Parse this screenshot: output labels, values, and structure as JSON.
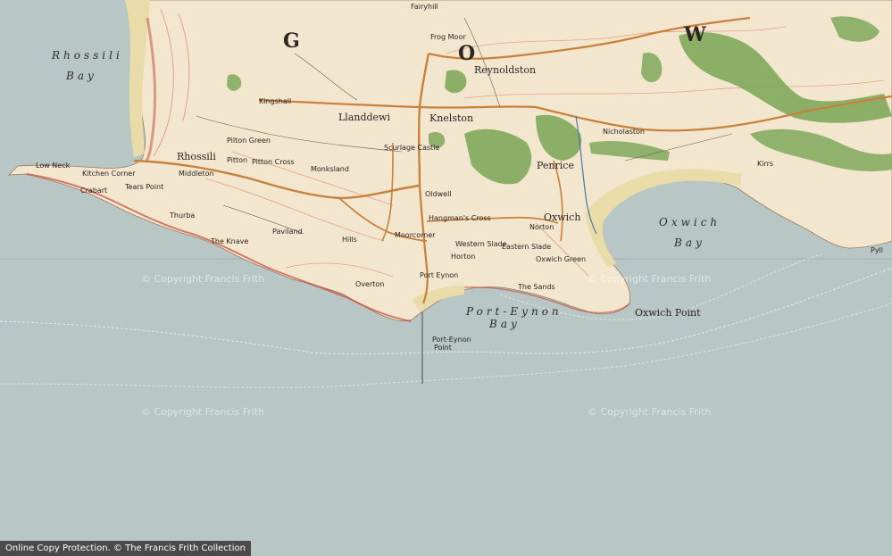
{
  "colors": {
    "sea": "#b9c6c6",
    "land": "#f3e6cf",
    "sand": "#e9dca8",
    "woodland": "#7fa85a",
    "road": "#c8813a",
    "contour": "#e3a08a",
    "cliff": "#c24a3a"
  },
  "bays": {
    "rhossili": [
      "Rhossili",
      "Bay"
    ],
    "oxwich": [
      "Oxwich",
      "Bay"
    ],
    "port_eynon": [
      "Port-Eynon",
      "Bay"
    ]
  },
  "big_letters": [
    "G",
    "O",
    "W"
  ],
  "places": [
    {
      "id": "rhossili",
      "text": "Rhossili"
    },
    {
      "id": "llanddewi",
      "text": "Llanddewi"
    },
    {
      "id": "knelston",
      "text": "Knelston"
    },
    {
      "id": "reynoldston",
      "text": "Reynoldston"
    },
    {
      "id": "penrice",
      "text": "Penrice"
    },
    {
      "id": "oxwich",
      "text": "Oxwich"
    },
    {
      "id": "port-eynon",
      "text": "Port Eynon"
    },
    {
      "id": "horton",
      "text": "Horton"
    },
    {
      "id": "overton",
      "text": "Overton"
    },
    {
      "id": "scurlage",
      "text": "Scurlage Castle"
    },
    {
      "id": "pitton",
      "text": "Pitton"
    },
    {
      "id": "middleton",
      "text": "Middleton"
    },
    {
      "id": "kingshall",
      "text": "Kingshall"
    },
    {
      "id": "nicholaston",
      "text": "Nicholaston"
    },
    {
      "id": "moorcorner",
      "text": "Moorcorner"
    },
    {
      "id": "hangmans-cross",
      "text": "Hangman's Cross"
    },
    {
      "id": "pilton-green",
      "text": "Pilton Green"
    },
    {
      "id": "pitton-cross",
      "text": "Pitton Cross"
    },
    {
      "id": "oldwell",
      "text": "Oldwell"
    },
    {
      "id": "norton",
      "text": "Norton"
    },
    {
      "id": "eastern-slade",
      "text": "Eastern Slade"
    },
    {
      "id": "western-slade",
      "text": "Western Slade"
    },
    {
      "id": "the-sands",
      "text": "The Sands"
    },
    {
      "id": "low-neck",
      "text": "Low Neck"
    },
    {
      "id": "kitchen-corner",
      "text": "Kitchen Corner"
    },
    {
      "id": "crabart",
      "text": "Crabart"
    },
    {
      "id": "tears-point",
      "text": "Tears Point"
    },
    {
      "id": "thurba",
      "text": "Thurba"
    },
    {
      "id": "the-knave",
      "text": "The Knave"
    },
    {
      "id": "paviland",
      "text": "Paviland"
    },
    {
      "id": "monksland",
      "text": "Monksland"
    },
    {
      "id": "hills",
      "text": "Hills"
    },
    {
      "id": "fairyhill",
      "text": "Fairyhill"
    },
    {
      "id": "frog-moor",
      "text": "Frog Moor"
    },
    {
      "id": "oxwich-green",
      "text": "Oxwich Green"
    },
    {
      "id": "pyll",
      "text": "Pyll"
    },
    {
      "id": "kirrs",
      "text": "Kirrs"
    }
  ],
  "points": {
    "oxwich_point": "Oxwich Point",
    "port_eynon_point": [
      "Port-Eynon",
      "Point"
    ]
  },
  "watermarks": [
    "© Copyright Francis Frith",
    "© Copyright Francis Frith",
    "© Copyright Francis Frith",
    "© Copyright Francis Frith"
  ],
  "footer": "Online Copy Protection.  © The Francis Frith Collection"
}
